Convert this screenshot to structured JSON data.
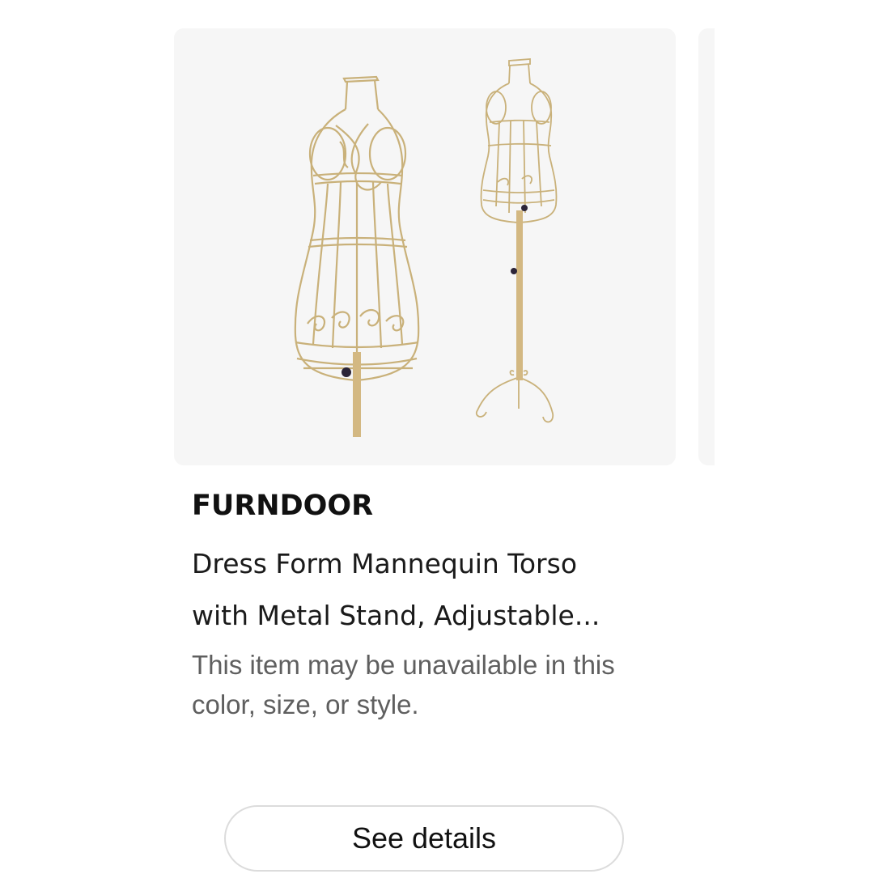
{
  "product": {
    "brand": "FURNDOOR",
    "title_line1": "Dress Form Mannequin Torso",
    "title_line2": "with Metal Stand, Adjustable...",
    "availability_note": "This item may be unavailable in this color, size, or style.",
    "image_alt": "Gold wire dress form mannequin torso and full mannequin on metal stand"
  },
  "actions": {
    "see_details_label": "See details"
  },
  "colors": {
    "image_background": "#f6f6f6",
    "wire_gold": "#c9b17a",
    "stand_gold": "#d3b882",
    "knob": "#2b2438"
  }
}
